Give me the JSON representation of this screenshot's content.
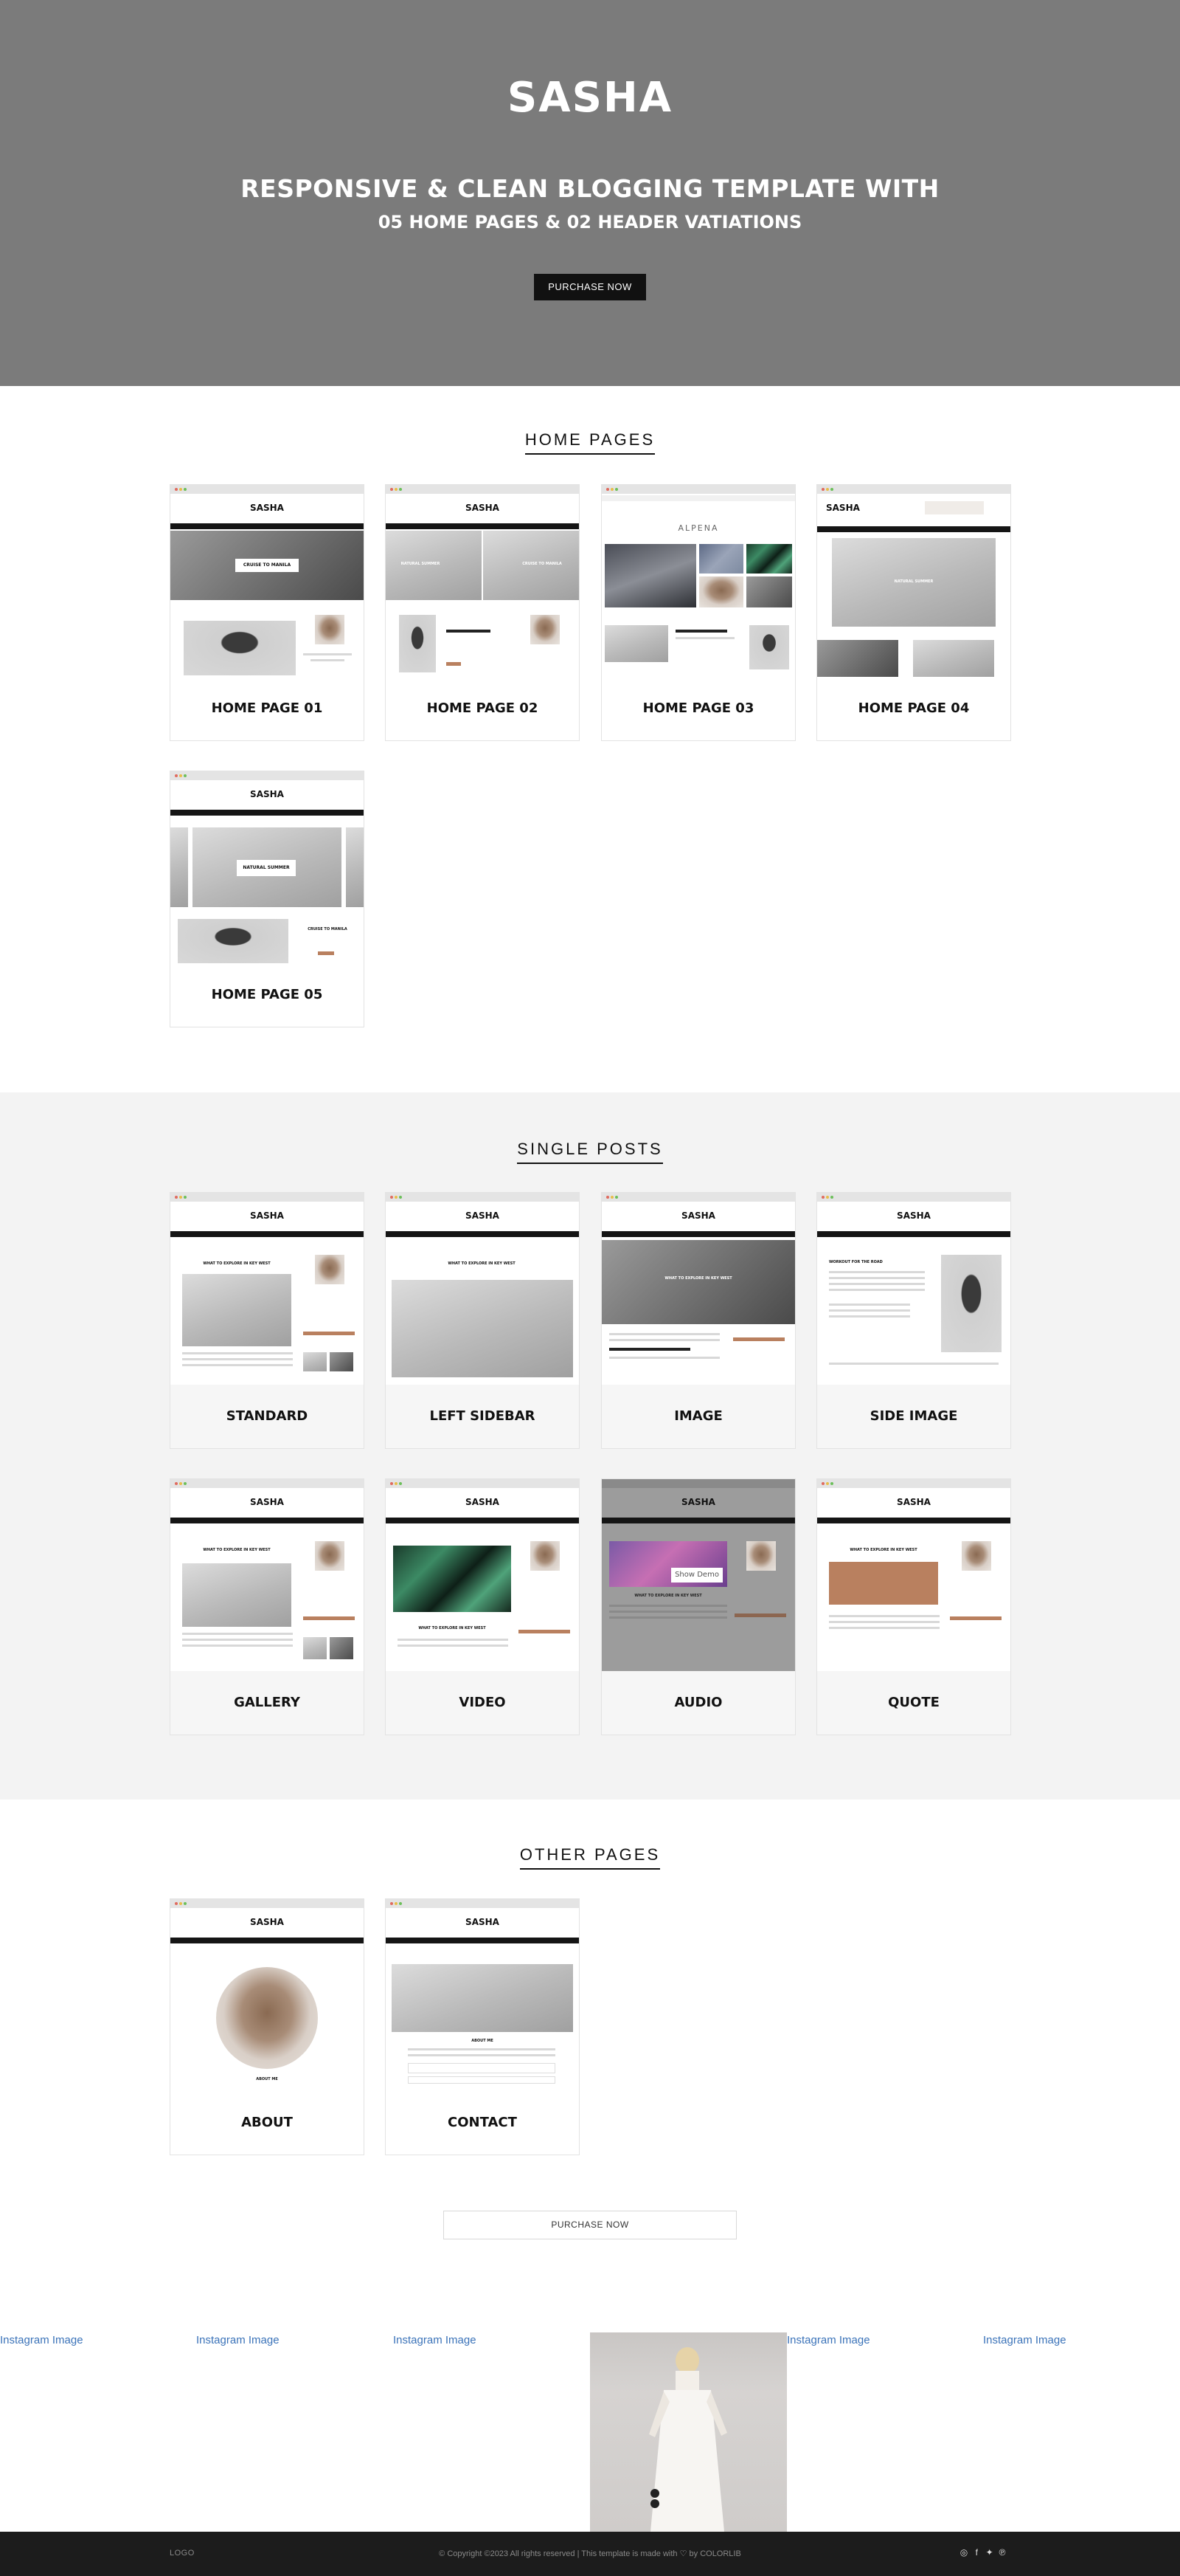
{
  "hero": {
    "title": "SASHA",
    "subtitle_line1": "RESPONSIVE & CLEAN BLOGGING TEMPLATE WITH",
    "subtitle_line2": "05 HOME PAGES & 02 HEADER VATIATIONS",
    "purchase_label": "PURCHASE NOW"
  },
  "home_pages": {
    "title": "HOME PAGES",
    "items": [
      "HOME PAGE 01",
      "HOME PAGE 02",
      "HOME PAGE 03",
      "HOME PAGE 04",
      "HOME PAGE 05"
    ]
  },
  "single_posts": {
    "title": "SINGLE POSTS",
    "items": [
      "STANDARD",
      "LEFT SIDEBAR",
      "IMAGE",
      "SIDE IMAGE",
      "GALLERY",
      "VIDEO",
      "AUDIO",
      "QUOTE"
    ]
  },
  "other_pages": {
    "title": "OTHER PAGES",
    "items": [
      "ABOUT",
      "CONTACT"
    ]
  },
  "previews": {
    "brand": "SASHA",
    "alt_brand": "ALPENA",
    "cruise": "CRUISE TO MANILA",
    "natural": "NATURAL SUMMER",
    "post_title": "WHAT TO EXPLORE IN KEY WEST",
    "side_title": "WORKOUT FOR THE ROAD",
    "show_demo": "Show Demo",
    "about_me": "ABOUT ME"
  },
  "bottom_purchase_label": "PURCHASE NOW",
  "instagram": {
    "link_label": "Instagram Image",
    "count_links": 5
  },
  "footer": {
    "logo": "LOGO",
    "copyright": "© Copyright ©2023 All rights reserved | This template is made with",
    "heart": "♡",
    "credit": "by COLORLIB",
    "social_icons": [
      "instagram-icon",
      "facebook-icon",
      "twitter-icon",
      "pinterest-icon"
    ]
  },
  "colors": {
    "hero_bg": "#7b7b7b",
    "accent": "#b9805f",
    "link": "#3b73b9",
    "footer_bg": "#1c1c1c"
  }
}
